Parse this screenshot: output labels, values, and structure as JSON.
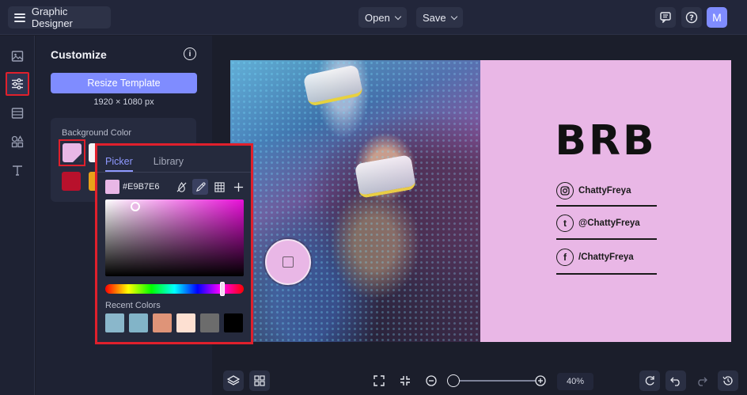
{
  "header": {
    "app_title": "Graphic Designer",
    "open_label": "Open",
    "save_label": "Save",
    "avatar_initial": "M"
  },
  "panel": {
    "title": "Customize",
    "resize_button": "Resize Template",
    "dimensions": "1920 × 1080 px",
    "background_label": "Background Color",
    "selected_color": "#e9b7e6"
  },
  "picker": {
    "tab_picker": "Picker",
    "tab_library": "Library",
    "hex_value": "#E9B7E6",
    "recent_label": "Recent Colors",
    "recent_colors": [
      "#8ab7cb",
      "#82b4c8",
      "#df9478",
      "#fde0d2",
      "#6c6c6c",
      "#000000"
    ]
  },
  "design": {
    "headline": "BRB",
    "instagram": "ChattyFreya",
    "tumblr": "@ChattyFreya",
    "facebook": "/ChattyFreya",
    "background": "#e9b7e6"
  },
  "toolbar": {
    "zoom": "40%"
  },
  "colors": {
    "accent": "#7f8cff",
    "highlight": "#e0202c"
  }
}
